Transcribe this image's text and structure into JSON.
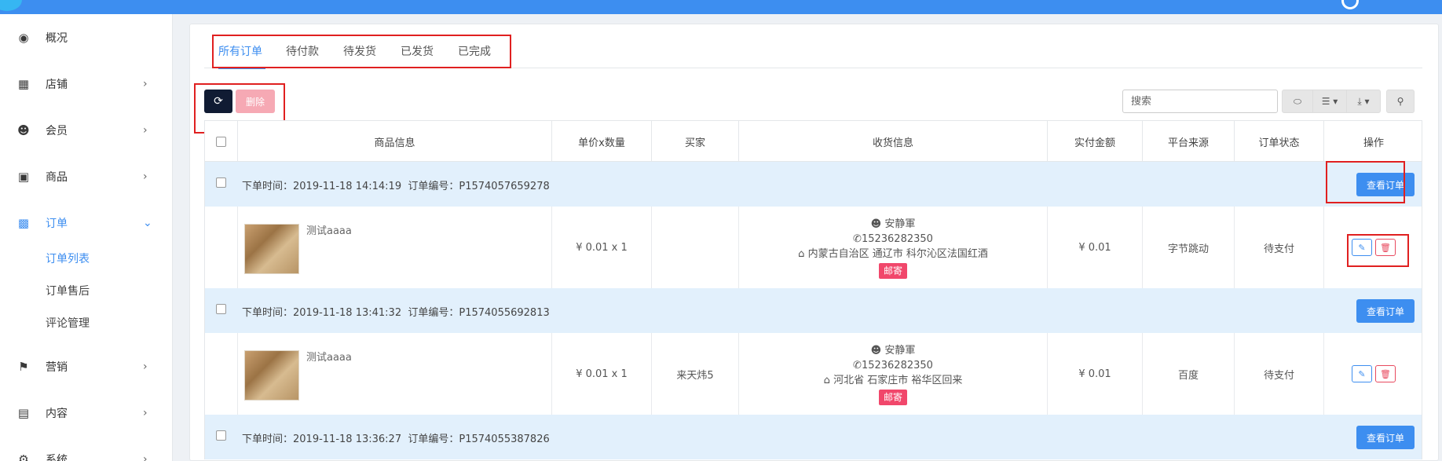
{
  "sidebar": {
    "items": [
      {
        "label": "概况",
        "icon": "dashboard-icon"
      },
      {
        "label": "店铺",
        "icon": "grid-icon"
      },
      {
        "label": "会员",
        "icon": "users-icon"
      },
      {
        "label": "商品",
        "icon": "cart-icon"
      },
      {
        "label": "订单",
        "icon": "money-icon"
      },
      {
        "label": "营销",
        "icon": "flag-icon"
      },
      {
        "label": "内容",
        "icon": "document-icon"
      },
      {
        "label": "系统",
        "icon": "gear-icon"
      }
    ],
    "sub_items": [
      "订单列表",
      "订单售后",
      "评论管理"
    ],
    "active_item": "订单",
    "active_sub": "订单列表"
  },
  "tabs": [
    "所有订单",
    "待付款",
    "待发货",
    "已发货",
    "已完成"
  ],
  "toolbar": {
    "delete_label": "删除",
    "search_placeholder": "搜索"
  },
  "table": {
    "headers": [
      "商品信息",
      "单价x数量",
      "买家",
      "收货信息",
      "实付金额",
      "平台来源",
      "订单状态",
      "操作"
    ],
    "view_label": "查看订单",
    "orders": [
      {
        "time_label": "下单时间：",
        "time": "2019-11-18 14:14:19",
        "no_label": "订单编号：",
        "no": "P1574057659278",
        "goods_name": "测试aaaa",
        "price_qty": "¥ 0.01 x 1",
        "buyer": "",
        "ship_name": "安静軍",
        "ship_phone": "15236282350",
        "ship_addr": "内蒙古自治区 通辽市 科尔沁区法国红酒",
        "ship_method": "邮寄",
        "paid": "¥ 0.01",
        "platform": "字节跳动",
        "status": "待支付"
      },
      {
        "time_label": "下单时间：",
        "time": "2019-11-18 13:41:32",
        "no_label": "订单编号：",
        "no": "P1574055692813",
        "goods_name": "测试aaaa",
        "price_qty": "¥ 0.01 x 1",
        "buyer": "来天炜5",
        "ship_name": "安静軍",
        "ship_phone": "15236282350",
        "ship_addr": "河北省 石家庄市 裕华区回来",
        "ship_method": "邮寄",
        "paid": "¥ 0.01",
        "platform": "百度",
        "status": "待支付"
      },
      {
        "time_label": "下单时间：",
        "time": "2019-11-18 13:36:27",
        "no_label": "订单编号：",
        "no": "P1574055387826"
      }
    ]
  },
  "colors": {
    "accent": "#3d8ef0",
    "highlight_box": "#e02020",
    "row_header_bg": "#e2f0fc",
    "badge": "#f1476b"
  }
}
